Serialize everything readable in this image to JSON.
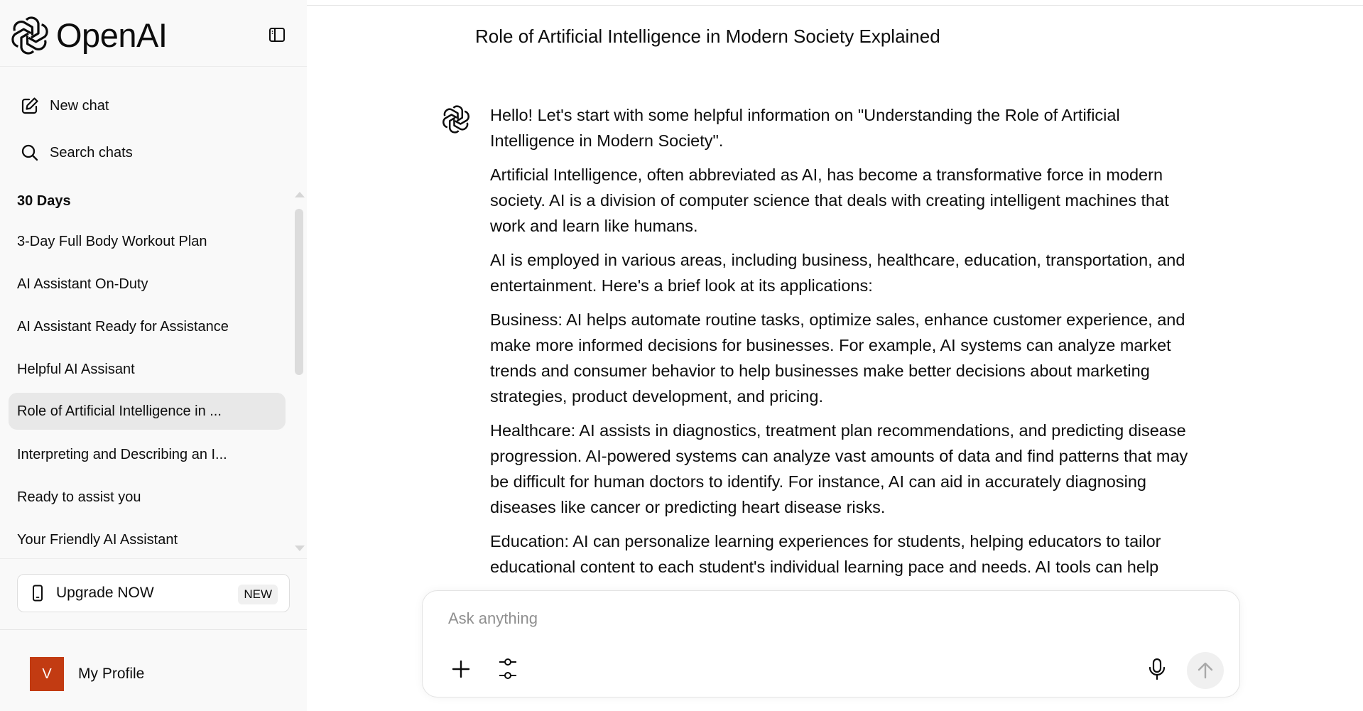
{
  "brand": {
    "name": "OpenAI"
  },
  "sidebar": {
    "nav": [
      {
        "label": "New chat",
        "icon": "compose-icon"
      },
      {
        "label": "Search chats",
        "icon": "search-icon"
      }
    ],
    "section_title": "30 Days",
    "chats": [
      {
        "label": "3-Day Full Body Workout Plan",
        "active": false
      },
      {
        "label": "AI Assistant On-Duty",
        "active": false
      },
      {
        "label": "AI Assistant Ready for Assistance",
        "active": false
      },
      {
        "label": "Helpful AI Assisant",
        "active": false
      },
      {
        "label": "Role of Artificial Intelligence in ...",
        "active": true
      },
      {
        "label": "Interpreting and Describing an I...",
        "active": false
      },
      {
        "label": "Ready to assist you",
        "active": false
      },
      {
        "label": "Your Friendly AI Assistant",
        "active": false
      }
    ],
    "upgrade": {
      "label": "Upgrade NOW",
      "badge": "NEW"
    },
    "profile": {
      "initial": "V",
      "name": "My Profile",
      "avatar_color": "#c23b12"
    }
  },
  "main": {
    "title": "Role of Artificial Intelligence in Modern Society Explained",
    "message": {
      "paragraphs": [
        "Hello! Let's start with some helpful information on \"Understanding the Role of Artificial Intelligence in Modern Society\".",
        "Artificial Intelligence, often abbreviated as AI, has become a transformative force in modern society. AI is a division of computer science that deals with creating intelligent machines that work and learn like humans.",
        "AI is employed in various areas, including business, healthcare, education, transportation, and entertainment. Here's a brief look at its applications:",
        "Business: AI helps automate routine tasks, optimize sales, enhance customer experience, and make more informed decisions for businesses. For example, AI systems can analyze market trends and consumer behavior to help businesses make better decisions about marketing strategies, product development, and pricing.",
        "Healthcare: AI assists in diagnostics, treatment plan recommendations, and predicting disease progression. AI-powered systems can analyze vast amounts of data and find patterns that may be difficult for human doctors to identify. For instance, AI can aid in accurately diagnosing diseases like cancer or predicting heart disease risks.",
        "Education: AI can personalize learning experiences for students, helping educators to tailor educational content to each student's individual learning pace and needs. AI tools can help"
      ]
    },
    "composer": {
      "placeholder": "Ask anything"
    }
  }
}
